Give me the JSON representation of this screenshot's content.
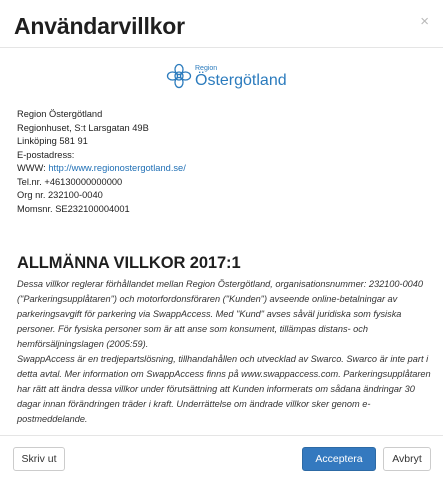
{
  "dialog": {
    "title": "Användarvillkor",
    "close_symbol": "×"
  },
  "logo": {
    "region": "Region",
    "name": "Östergötland",
    "icon": "region-flower-icon",
    "color": "#2b7bbd"
  },
  "contact": {
    "org_name": "Region Östergötland",
    "address1": "Regionhuset, S:t Larsgatan 49B",
    "address2": "Linköping 581 91",
    "email_label": "E-postadress:",
    "www_label": "WWW:",
    "www_link": "http://www.regionostergotland.se/",
    "phone": "Tel.nr. +46130000000000",
    "org_nr": "Org nr. 232100-0040",
    "vat": "Momsnr. SE232100004001"
  },
  "terms": {
    "heading": "ALLMÄNNA VILLKOR 2017:1",
    "paragraph1": "Dessa villkor reglerar förhållandet mellan Region Östergötland, organisationsnummer: 232100-0040 (\"Parkeringsupplåtaren\") och motorfordonsföraren (\"Kunden\") avseende online-betalningar av parkeringsavgift för parkering via SwappAccess. Med \"Kund\" avses såväl juridiska som fysiska personer. För fysiska personer som är att anse som konsument, tillämpas distans- och hemförsäljningslagen (2005:59).",
    "paragraph2": "SwappAccess är en tredjepartslösning, tillhandahållen och utvecklad av Swarco. Swarco är inte part i detta avtal. Mer information om SwappAccess finns på www.swappaccess.com. Parkeringsupplåtaren har rätt att ändra dessa villkor under förutsättning att Kunden informerats om sådana ändringar 30 dagar innan förändringen träder i kraft. Underrättelse om ändrade villkor sker genom e-postmeddelande."
  },
  "footer": {
    "print_label": "Skriv ut",
    "accept_label": "Acceptera",
    "cancel_label": "Avbryt",
    "accent": "#3479bf"
  }
}
